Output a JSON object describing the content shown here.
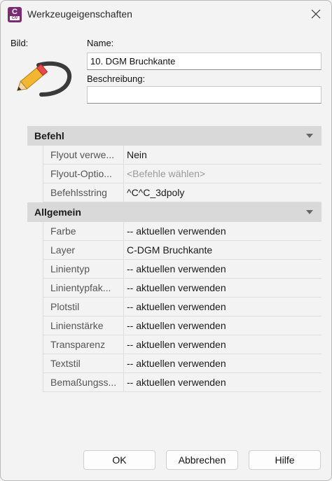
{
  "window": {
    "title": "Werkzeugeigenschaften",
    "app_icon_letter": "C",
    "app_icon_sub": "CIV"
  },
  "form": {
    "image_label": "Bild:",
    "name_label": "Name:",
    "name_value": "10. DGM Bruchkante",
    "description_label": "Beschreibung:",
    "description_value": ""
  },
  "sections": [
    {
      "title": "Befehl",
      "rows": [
        {
          "key": "Flyout verwe...",
          "value": "Nein",
          "placeholder": false
        },
        {
          "key": "Flyout-Optio...",
          "value": "<Befehle wählen>",
          "placeholder": true
        },
        {
          "key": "Befehlsstring",
          "value": "^C^C_3dpoly",
          "placeholder": false
        }
      ]
    },
    {
      "title": "Allgemein",
      "rows": [
        {
          "key": "Farbe",
          "value": "-- aktuellen verwenden",
          "placeholder": false
        },
        {
          "key": "Layer",
          "value": "C-DGM Bruchkante",
          "placeholder": false
        },
        {
          "key": "Linientyp",
          "value": "-- aktuellen verwenden",
          "placeholder": false
        },
        {
          "key": "Linientypfak...",
          "value": "-- aktuellen verwenden",
          "placeholder": false
        },
        {
          "key": "Plotstil",
          "value": "-- aktuellen verwenden",
          "placeholder": false
        },
        {
          "key": "Linienstärke",
          "value": "-- aktuellen verwenden",
          "placeholder": false
        },
        {
          "key": "Transparenz",
          "value": "-- aktuellen verwenden",
          "placeholder": false
        },
        {
          "key": "Textstil",
          "value": "-- aktuellen verwenden",
          "placeholder": false
        },
        {
          "key": "Bemaßungss...",
          "value": "-- aktuellen verwenden",
          "placeholder": false
        }
      ]
    }
  ],
  "buttons": {
    "ok": "OK",
    "cancel": "Abbrechen",
    "help": "Hilfe"
  },
  "colors": {
    "accent": "#7b2b74",
    "section_header": "#d9d9d9",
    "pencil_body": "#f2b632",
    "pencil_tip": "#e84a4a"
  }
}
